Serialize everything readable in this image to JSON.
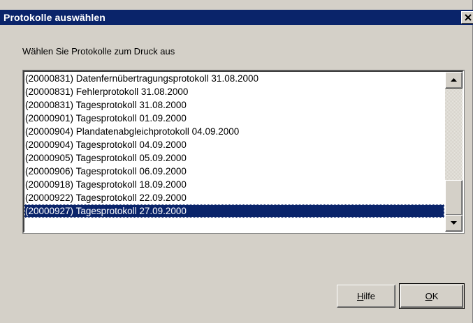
{
  "window": {
    "title": "Protokolle auswählen",
    "colors": {
      "titlebar": "#0a246a",
      "face": "#d4d0c8",
      "selection": "#0a246a"
    }
  },
  "prompt": "Wählen Sie Protokolle zum Druck aus",
  "list": {
    "items": [
      "(20000831) Datenfernübertragungsprotokoll 31.08.2000",
      "(20000831) Fehlerprotokoll 31.08.2000",
      "(20000831) Tagesprotokoll 31.08.2000",
      "(20000901) Tagesprotokoll 01.09.2000",
      "(20000904) Plandatenabgleichprotokoll 04.09.2000",
      "(20000904) Tagesprotokoll 04.09.2000",
      "(20000905) Tagesprotokoll 05.09.2000",
      "(20000906) Tagesprotokoll 06.09.2000",
      "(20000918) Tagesprotokoll 18.09.2000",
      "(20000922) Tagesprotokoll 22.09.2000",
      "(20000927) Tagesprotokoll 27.09.2000"
    ],
    "selected_index": 10
  },
  "buttons": {
    "help": {
      "accel": "H",
      "rest": "ilfe"
    },
    "ok": {
      "accel": "O",
      "rest": "K"
    }
  },
  "icons": {
    "close": "close-icon",
    "scroll_up": "arrow-up-icon",
    "scroll_down": "arrow-down-icon"
  }
}
